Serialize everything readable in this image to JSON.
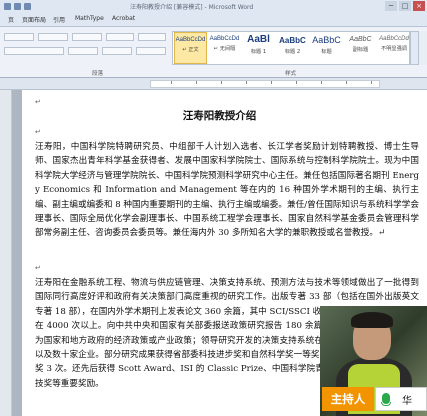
{
  "window": {
    "title": "汪寿阳教授介绍 [兼容模式] - Microsoft Word",
    "buttons": [
      "─",
      "□",
      "×"
    ]
  },
  "tabs": [
    "页",
    "页面布局",
    "引用",
    "MathType",
    "Acrobat"
  ],
  "ribbon": {
    "group_paragraph": "段落",
    "group_styles": "样式",
    "styles": [
      {
        "sample": "AaBbCcDd",
        "name": "↵ 正文",
        "selected": true
      },
      {
        "sample": "AaBbCcDd",
        "name": "↵ 无间隔",
        "selected": false
      },
      {
        "sample": "AaBl",
        "name": "标题 1",
        "selected": false
      },
      {
        "sample": "AaBbC",
        "name": "标题 2",
        "selected": false
      },
      {
        "sample": "AaBbC",
        "name": "标题",
        "selected": false
      },
      {
        "sample": "AaBbC",
        "name": "副标题",
        "selected": false
      },
      {
        "sample": "AaBbCcDd",
        "name": "不明显强调",
        "selected": false
      }
    ]
  },
  "document": {
    "title": "汪寿阳教授介绍",
    "paragraphs": [
      "汪寿阳，中国科学院特聘研究员、中组部千人计划入选者、长江学者奖励计划特聘教授、博士生导师、国家杰出青年科学基金获得者、发展中国家科学院院士、国际系统与控制科学院院士。现为中国科学院大学经济与管理学院院长、中国科学院预测科学研究中心主任。兼任包括国际著名期刊 Energy Economics 和 Information and Management 等在内的 16 种国外学术期刊的主编、执行主编、副主编或编委和 8 种国内重要期刊的主编、执行主编或编委。兼任/曾任国际知识与系统科学学会理事长、国际全局优化学会副理事长、中国系统工程学会理事长、国家自然科学基金委员会管理科学部常务副主任、咨询委员会委员等。兼任海内外 30 多所知名大学的兼职教授或名誉教授。↵",
      "汪寿阳在金融系统工程、物流与供应链管理、决策支持系统、预测方法与技术等领域做出了一批得到国际同行高度好评和政府有关决策部门高度重视的研究工作。出版专著 33 部（包括在国外出版英文专著 18 部），在国内外学术期刊上发表论文 360 余篇，其中 SCI/SSCI 收录 320 余篇，SSCI 引用在 4000 次以上。向中共中央和国家有关部委报送政策研究报告 180 余篇，不少政策建议被采纳，为国家和地方政府的经济政策或产业政策；领导研究开发的决策支持系统在多家大型企业和政府部门以及数十家企业。部分研究成果获得省部委科技进步奖和自然科学奖一等奖 4 次、二等奖 6 次、三等奖 3 次。还先后获得 Scott Award、ISI 的 Classic Prize、中国科学院青年科学家奖、中国青年科技奖等重要奖励。"
    ]
  },
  "overlay": {
    "host_label": "主持人",
    "speaker_name": "华"
  },
  "colors": {
    "ribbon_bg": "#eef2f8",
    "host_tag": "#f29400",
    "mic_green": "#2aa84a",
    "heading_blue": "#1a3d7c"
  }
}
